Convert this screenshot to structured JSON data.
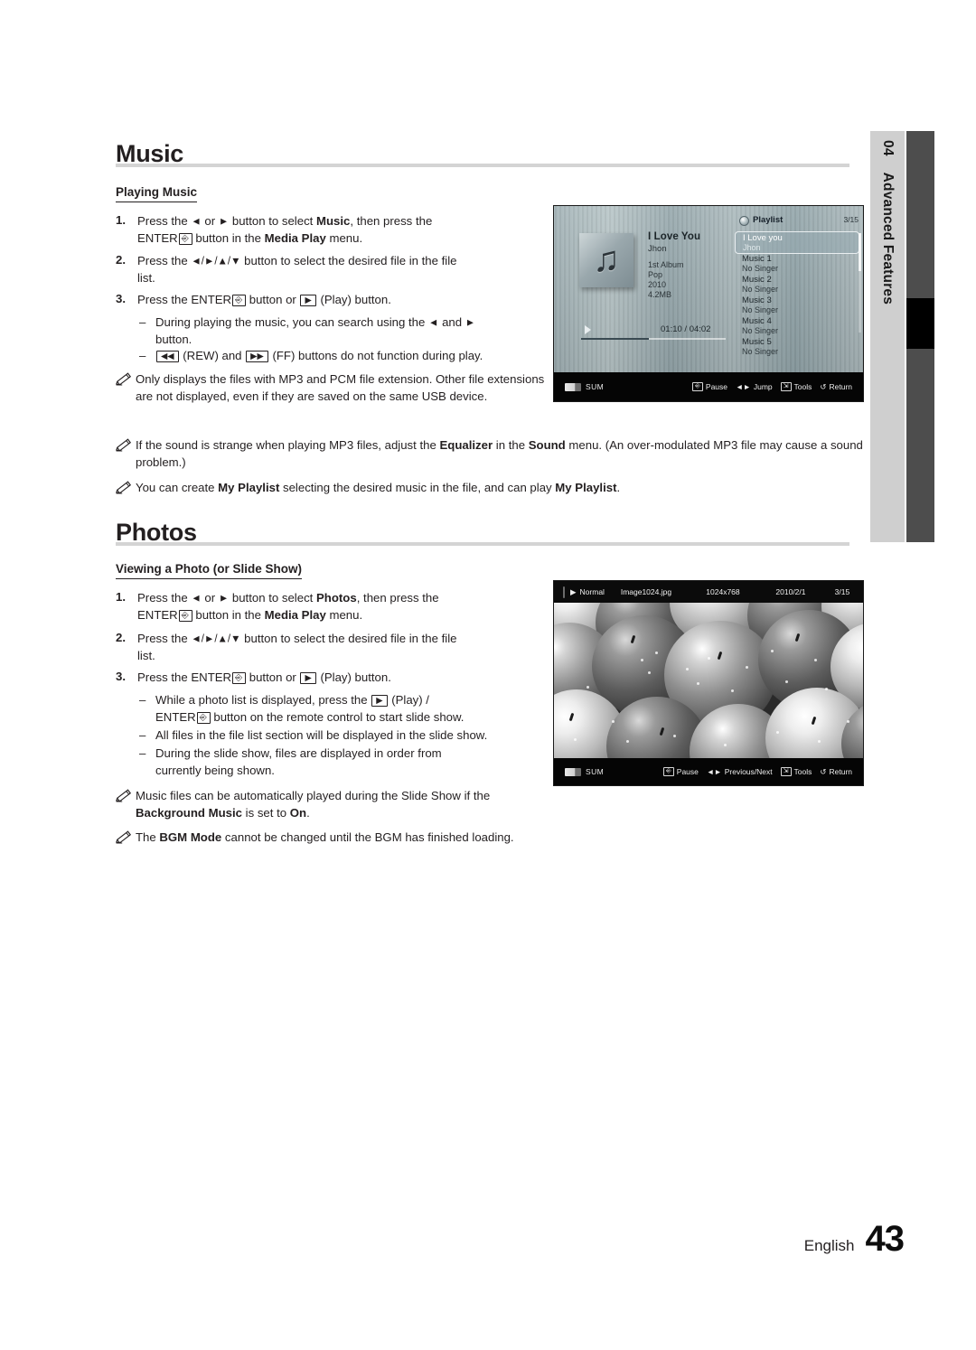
{
  "side_tab": {
    "number": "04",
    "label": "Advanced Features"
  },
  "sections": [
    {
      "title": "Music",
      "subtitle": "Playing Music",
      "steps": [
        {
          "n": "1.",
          "html_key": "music_step1"
        },
        {
          "n": "2.",
          "html_key": "music_step2"
        },
        {
          "n": "3.",
          "html_key": "music_step3"
        }
      ]
    },
    {
      "title": "Photos",
      "subtitle": "Viewing a Photo (or Slide Show)"
    }
  ],
  "music": {
    "heading": "Music",
    "subheading": "Playing Music",
    "step1_a": "Press the ",
    "step1_b": " or ",
    "step1_c": " button to select ",
    "step1_target": "Music",
    "step1_d": ", then press the",
    "step1_line2_a": "ENTER",
    "step1_line2_b": " button in the ",
    "step1_line2_menu": "Media Play",
    "step1_line2_c": " menu.",
    "step2_a": "Press the ",
    "step2_arrows": "◄/►/▲/▼",
    "step2_b": " button to select the desired file in the file",
    "step2_line2": "list.",
    "step3_a": "Press the ENTER",
    "step3_b": " button or ",
    "step3_c": " (Play) button.",
    "dash1_a": "During playing the music, you can search using the ",
    "dash1_b": " and ",
    "dash1_line2": "button.",
    "dash2_a": " (REW) and ",
    "dash2_b": " (FF) buttons do not function during play.",
    "note1": "Only displays the files with MP3 and PCM file extension. Other file extensions are not displayed, even if they are saved on the same USB device.",
    "note2_a": "If the sound is strange when playing MP3 files, adjust the ",
    "note2_eq": "Equalizer",
    "note2_b": " in the ",
    "note2_sound": "Sound",
    "note2_c": " menu. (An over-modulated MP3 file may cause a sound problem.)",
    "note3_a": "You can create ",
    "note3_mp1": "My Playlist",
    "note3_b": " selecting the desired music in the file, and can play ",
    "note3_mp2": "My Playlist",
    "note3_c": "."
  },
  "photos": {
    "heading": "Photos",
    "subheading": "Viewing a Photo (or Slide Show)",
    "step1_a": "Press the ",
    "step1_b": " or ",
    "step1_c": " button to select ",
    "step1_target": "Photos",
    "step1_d": ", then press the",
    "step1_line2_a": "ENTER",
    "step1_line2_b": " button in the ",
    "step1_line2_menu": "Media Play",
    "step1_line2_c": " menu.",
    "step2_a": "Press the ",
    "step2_arrows": "◄/►/▲/▼",
    "step2_b": " button to select the desired file in the file",
    "step2_line2": "list.",
    "step3_a": "Press the ENTER",
    "step3_b": " button or ",
    "step3_c": " (Play) button.",
    "dash1_a": "While a photo list is displayed, press the ",
    "dash1_b": " (Play) /",
    "dash1_line2_a": "ENTER",
    "dash1_line2_b": " button on the remote control to start slide show.",
    "dash2": "All files in the file list section will be displayed in the slide show.",
    "dash3_a": "During the slide show, files are displayed in order from",
    "dash3_b": "currently being shown.",
    "note1_a": "Music files can be automatically played during the Slide Show if the ",
    "note1_bgm": "Background Music",
    "note1_b": " is set to ",
    "note1_on": "On",
    "note1_c": ".",
    "note2_a": "The ",
    "note2_bgm": "BGM Mode",
    "note2_b": " cannot be changed until the BGM has finished loading."
  },
  "music_screenshot": {
    "song_title": "I Love You",
    "song_artist": "Jhon",
    "meta": [
      "1st Album",
      "Pop",
      "2010",
      "4.2MB"
    ],
    "time_elapsed": "01:10",
    "time_total": "04:02",
    "time_display": "01:10 / 04:02",
    "playlist_label": "Playlist",
    "playlist_count": "3/15",
    "playlist": [
      {
        "title": "I Love you",
        "singer": "Jhon",
        "selected": true
      },
      {
        "title": "Music 1",
        "singer": "No Singer",
        "selected": false
      },
      {
        "title": "Music 2",
        "singer": "No Singer",
        "selected": false
      },
      {
        "title": "Music 3",
        "singer": "No Singer",
        "selected": false
      },
      {
        "title": "Music 4",
        "singer": "No Singer",
        "selected": false
      },
      {
        "title": "Music 5",
        "singer": "No Singer",
        "selected": false
      }
    ],
    "source_label": "SUM",
    "actions": [
      {
        "key": "ENTER",
        "label": "Pause"
      },
      {
        "key": "◄►",
        "label": "Jump"
      },
      {
        "key": "TOOLS",
        "label": "Tools"
      },
      {
        "key": "RETURN",
        "label": "Return"
      }
    ]
  },
  "photo_screenshot": {
    "mode": "Normal",
    "filename": "Image1024.jpg",
    "resolution": "1024x768",
    "date": "2010/2/1",
    "counter": "3/15",
    "source_label": "SUM",
    "actions": [
      {
        "key": "ENTER",
        "label": "Pause"
      },
      {
        "key": "◄►",
        "label": "Previous/Next"
      },
      {
        "key": "TOOLS",
        "label": "Tools"
      },
      {
        "key": "RETURN",
        "label": "Return"
      }
    ]
  },
  "footer": {
    "language": "English",
    "page": "43"
  }
}
